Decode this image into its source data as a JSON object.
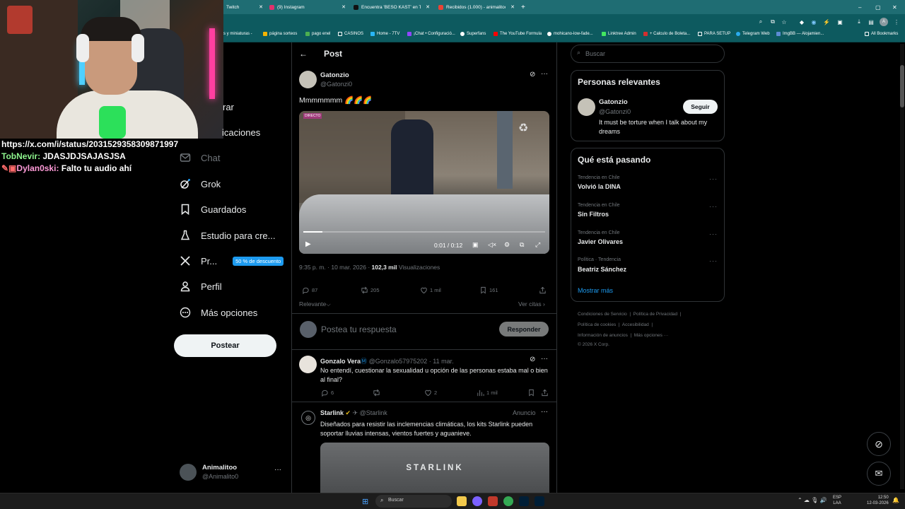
{
  "browser": {
    "tabs": [
      {
        "label": "Twitch",
        "color": "#9146ff"
      },
      {
        "label": "(9) Instagram",
        "color": "#e1306c"
      },
      {
        "label": "Encuentra 'BESO KAST' en TikTok",
        "color": "#111111"
      },
      {
        "label": "Recibidos (1.000) - animalitoo...",
        "color": "#ea4335"
      }
    ],
    "new_tab": "+",
    "bookmarks": [
      "s y miniaturas -",
      "página sorteos",
      "pago enel",
      "CASINOS",
      "Home - 7TV",
      "¡Chat • Configuració...",
      "Superfans",
      "The YouTube Formula",
      "mohicano-low-fade...",
      "Linktree Admin",
      "+ Calculo de Boleta...",
      "PARA SETUP",
      "Telegram Web",
      "ImgBB — Alojamien...",
      "All Bookmarks"
    ]
  },
  "stream_chat": [
    {
      "user": "",
      "msg": "https://x.com/i/status/2031529358309871997",
      "color": "#ffffff"
    },
    {
      "user": "TobNevir:",
      "msg": "JDASJDJSAJASJSA",
      "color": "#8ef58e"
    },
    {
      "user": "Dylan0ski:",
      "msg": "Falto tu audio ahí",
      "color": "#ff9bd8"
    }
  ],
  "sidebar": {
    "partial_items": [
      "rar",
      "icaciones"
    ],
    "items": [
      {
        "label": "Chat"
      },
      {
        "label": "Grok"
      },
      {
        "label": "Guardados"
      },
      {
        "label": "Estudio para cre..."
      },
      {
        "label": "Pr..."
      },
      {
        "label": "Perfil"
      },
      {
        "label": "Más opciones"
      }
    ],
    "premium_badge": "50 % de descuento",
    "post_button": "Postear",
    "account": {
      "name": "Animalitoo",
      "handle": "@Animalito0",
      "menu": "···"
    }
  },
  "post": {
    "header": "Post",
    "author": "Gatonzio",
    "handle": "@Gatonzi0",
    "text": "Mmmmmmm 🌈🌈🌈",
    "video": {
      "live_badge": "DIRECTO",
      "time": "0:01 / 0:12",
      "progress": 0.08
    },
    "meta_time": "9:35 p. m. · 10 mar. 2026 ·",
    "views": "102,3 mil",
    "views_label": "Visualizaciones",
    "stats": {
      "replies": "87",
      "reposts": "205",
      "likes": "1 mil",
      "bookmarks": "161"
    },
    "sort": "Relevante",
    "quotes": "Ver citas",
    "reply_placeholder": "Postea tu respuesta",
    "reply_button": "Responder"
  },
  "replies": [
    {
      "name": "Gonzalo Vera",
      "handle": "@Gonzalo57975202",
      "date": "· 11 mar.",
      "text": "No entendí, cuestionar la sexualidad u opción de las personas estaba mal o bien al final?",
      "stats": {
        "replies": "6",
        "likes": "2",
        "views": "1 mil"
      }
    },
    {
      "name": "Starlink",
      "handle": "@Starlink",
      "ad": "Anuncio",
      "text": "Diseñados para resistir las inclemencias climáticas, los kits Starlink pueden soportar lluvias intensas, vientos fuertes y aguanieve.",
      "media_text": "STARLINK"
    }
  ],
  "right": {
    "search_placeholder": "Buscar",
    "relevant_title": "Personas relevantes",
    "relevant": {
      "name": "Gatonzio",
      "handle": "@Gatonzi0",
      "bio": "It must be torture when I talk about my dreams",
      "follow": "Seguir"
    },
    "trending_title": "Qué está pasando",
    "trends": [
      {
        "context": "Tendencia en Chile",
        "title": "Volvió la DINA"
      },
      {
        "context": "Tendencia en Chile",
        "title": "Sin Filtros"
      },
      {
        "context": "Tendencia en Chile",
        "title": "Javier Olivares"
      },
      {
        "context": "Política · Tendencia",
        "title": "Beatriz Sánchez"
      }
    ],
    "show_more": "Mostrar más",
    "footer": [
      "Condiciones de Servicio",
      "Política de Privacidad",
      "Política de cookies",
      "Accesibilidad",
      "Información de anuncios",
      "Más opciones ···",
      "© 2026 X Corp."
    ]
  },
  "taskbar": {
    "search": "Buscar",
    "lang": "ESP",
    "lang2": "LAA",
    "time": "12:50",
    "date": "12-03-2026"
  }
}
